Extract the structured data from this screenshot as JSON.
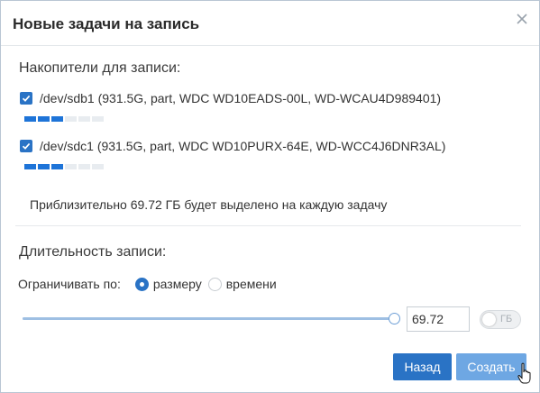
{
  "dialog": {
    "title": "Новые задачи на запись"
  },
  "drives": {
    "section_title": "Накопители для записи:",
    "items": [
      {
        "label": "/dev/sdb1 (931.5G, part, WDC WD10EADS-00L, WD-WCAU4D989401)",
        "checked": true,
        "meter_filled": 3,
        "meter_total": 6
      },
      {
        "label": "/dev/sdc1 (931.5G, part, WDC WD10PURX-64E, WD-WCC4J6DNR3AL)",
        "checked": true,
        "meter_filled": 3,
        "meter_total": 6
      }
    ],
    "estimate": "Приблизительно 69.72 ГБ будет выделено на каждую задачу"
  },
  "duration": {
    "section_title": "Длительность записи:",
    "limit_label": "Ограничивать по:",
    "options": [
      {
        "label": "размеру",
        "checked": true
      },
      {
        "label": "времени",
        "checked": false
      }
    ],
    "slider_fraction": 1.0,
    "value": "69.72",
    "unit_toggle_label": "ГБ",
    "unit_toggle_on": false
  },
  "buttons": {
    "back": "Назад",
    "create": "Создать"
  },
  "colors": {
    "primary": "#2a73c5",
    "primary_hover": "#6ea7e3",
    "meter_on": "#1e74d8",
    "meter_off": "#e8ecf0"
  },
  "icons": {
    "close": "close-icon",
    "check": "check-icon",
    "cursor": "hand-pointer-cursor"
  }
}
